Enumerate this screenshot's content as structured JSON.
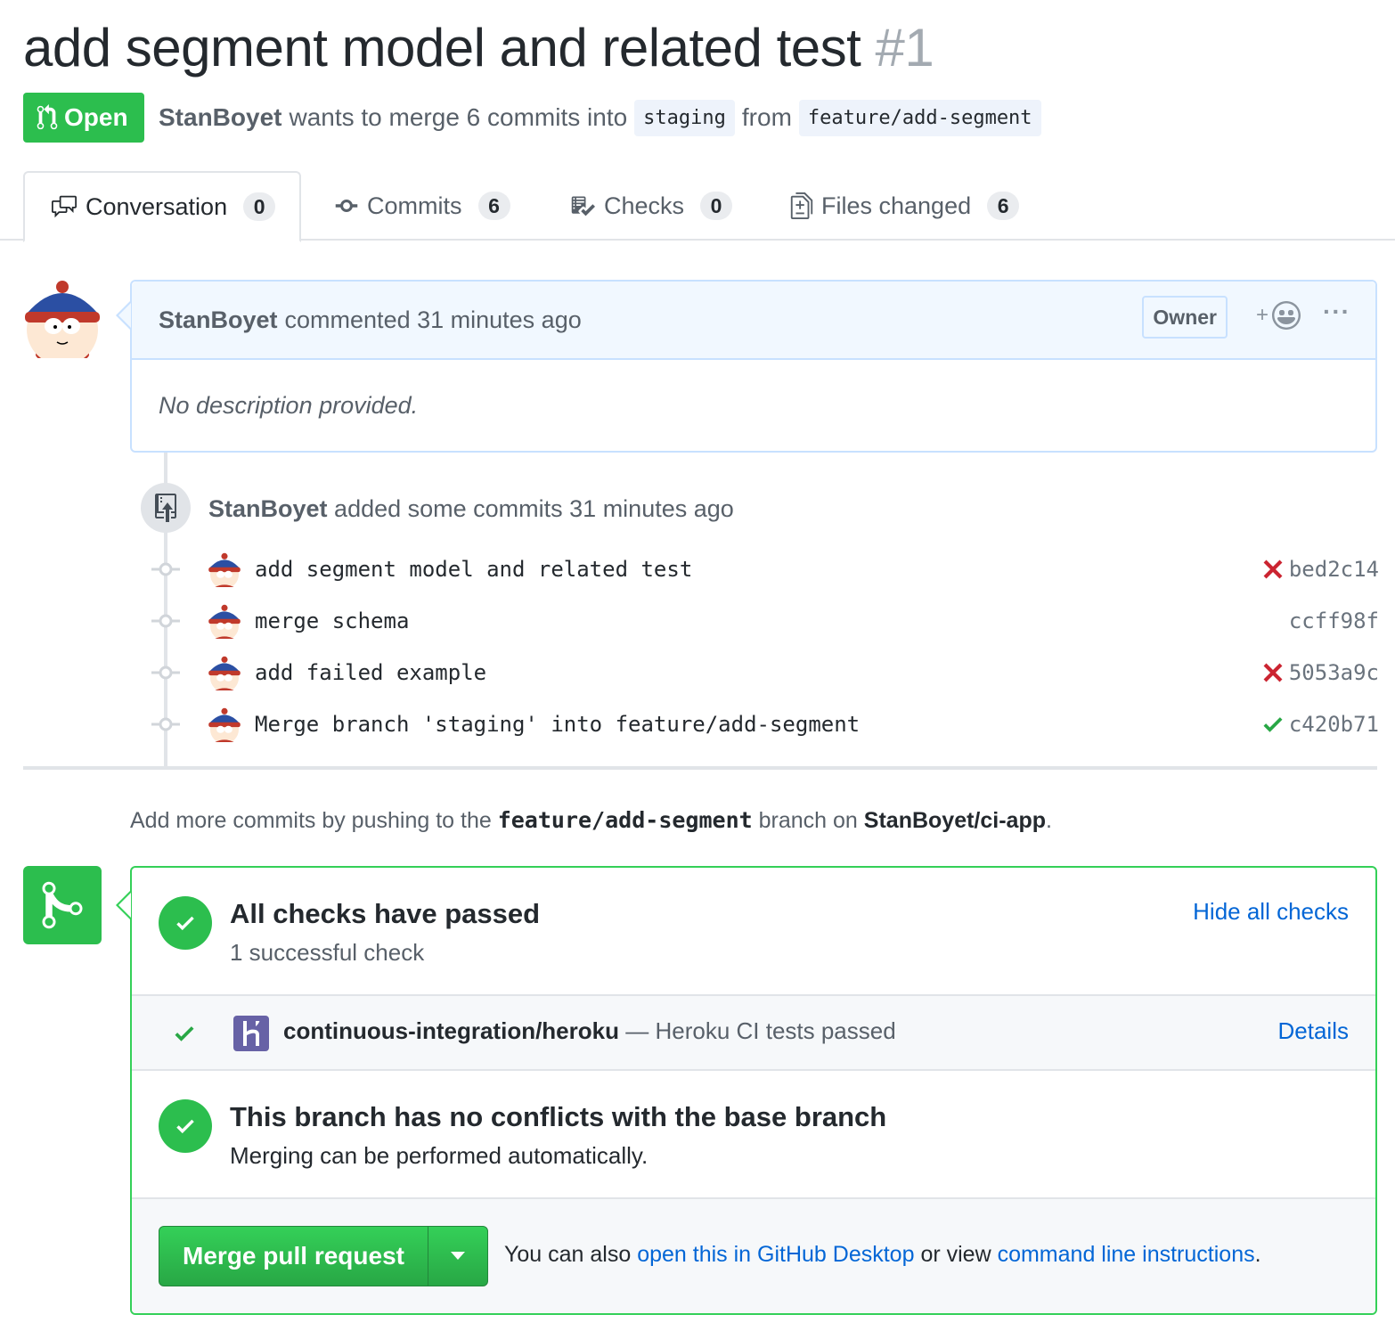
{
  "pr": {
    "title": "add segment model and related test",
    "number": "#1",
    "state": "Open",
    "author": "StanBoyet",
    "merge_text": "wants to merge 6 commits into",
    "base_branch": "staging",
    "from_text": "from",
    "head_branch": "feature/add-segment"
  },
  "tabs": [
    {
      "label": "Conversation",
      "count": "0",
      "icon": "comment-discussion-icon"
    },
    {
      "label": "Commits",
      "count": "6",
      "icon": "git-commit-icon"
    },
    {
      "label": "Checks",
      "count": "0",
      "icon": "checklist-icon"
    },
    {
      "label": "Files changed",
      "count": "6",
      "icon": "diff-icon"
    }
  ],
  "comment": {
    "author": "StanBoyet",
    "meta": "commented 31 minutes ago",
    "badge": "Owner",
    "react_plus": "+",
    "more": "···",
    "body": "No description provided."
  },
  "push_event": {
    "author": "StanBoyet",
    "text": "added some commits 31 minutes ago"
  },
  "commits": [
    {
      "message": "add segment model and related test",
      "status": "fail",
      "sha": "bed2c14"
    },
    {
      "message": "merge schema",
      "status": "none",
      "sha": "ccff98f"
    },
    {
      "message": "add failed example",
      "status": "fail",
      "sha": "5053a9c"
    },
    {
      "message": "Merge branch 'staging' into feature/add-segment",
      "status": "success",
      "sha": "c420b71"
    }
  ],
  "push_hint": {
    "prefix": "Add more commits by pushing to the",
    "branch": "feature/add-segment",
    "middle": "branch on",
    "repo": "StanBoyet/ci-app",
    "suffix": "."
  },
  "checks": {
    "title": "All checks have passed",
    "subtitle": "1 successful check",
    "toggle": "Hide all checks",
    "item_name": "continuous-integration/heroku",
    "item_desc": "— Heroku CI tests passed",
    "item_link": "Details"
  },
  "conflicts": {
    "title": "This branch has no conflicts with the base branch",
    "subtitle": "Merging can be performed automatically."
  },
  "merge_action": {
    "button": "Merge pull request",
    "also_prefix": "You can also",
    "desktop_link": "open this in GitHub Desktop",
    "or_text": "or view",
    "cli_link": "command line instructions",
    "end": "."
  },
  "colors": {
    "green": "#2cbe4e",
    "link": "#0366d6",
    "fail_red": "#cb2431",
    "heroku_purple": "#6762a6"
  }
}
